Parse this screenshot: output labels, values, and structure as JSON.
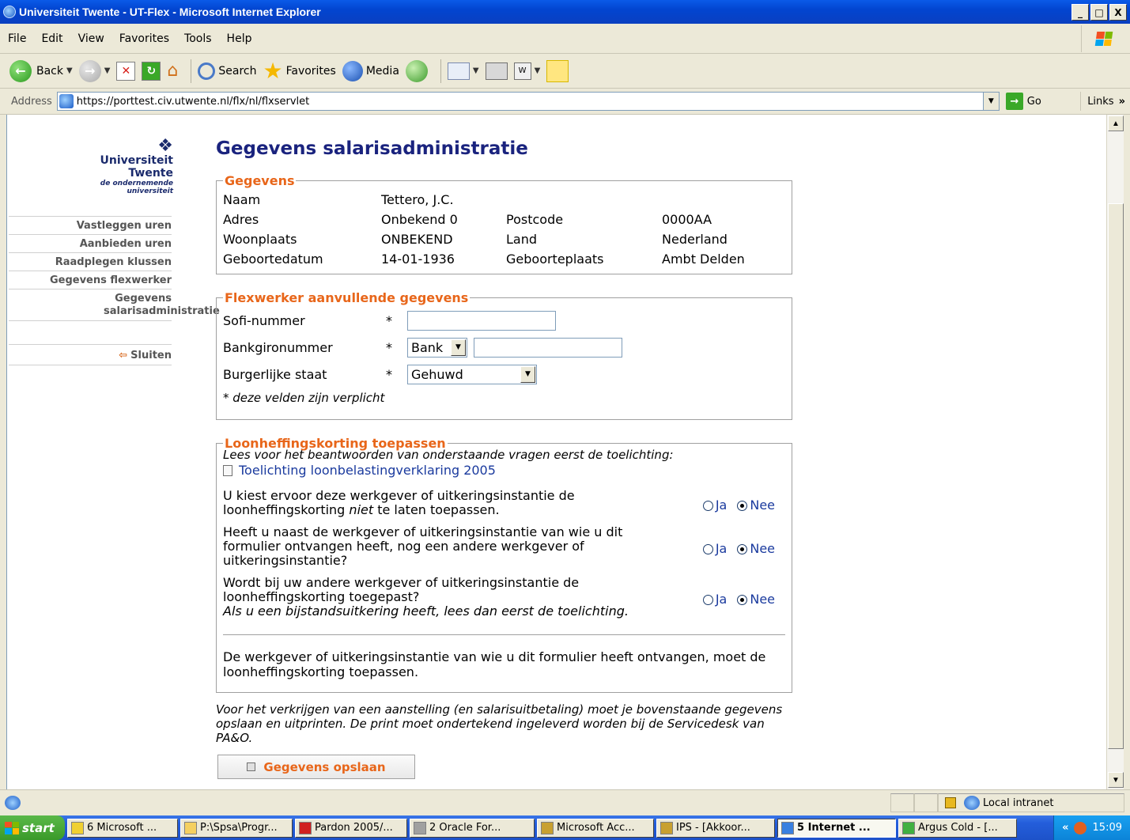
{
  "window": {
    "title": "Universiteit Twente - UT-Flex - Microsoft Internet Explorer",
    "minimize": "_",
    "maximize": "□",
    "close": "X"
  },
  "menu": [
    "File",
    "Edit",
    "View",
    "Favorites",
    "Tools",
    "Help"
  ],
  "toolbar": {
    "back": "Back",
    "search": "Search",
    "favorites": "Favorites",
    "media": "Media"
  },
  "address": {
    "label": "Address",
    "url": "https://porttest.civ.utwente.nl/flx/nl/flxservlet",
    "go": "Go",
    "links": "Links"
  },
  "logo": {
    "title": "Universiteit Twente",
    "subtitle": "de ondernemende universiteit"
  },
  "sidebar": {
    "items": [
      "Vastleggen uren",
      "Aanbieden uren",
      "Raadplegen klussen",
      "Gegevens flexwerker",
      "Gegevens salarisadministratie"
    ],
    "close": "Sluiten"
  },
  "page": {
    "title": "Gegevens salarisadministratie"
  },
  "gegevens": {
    "legend": "Gegevens",
    "naam_label": "Naam",
    "naam_value": "Tettero, J.C.",
    "adres_label": "Adres",
    "adres_value": "Onbekend 0",
    "postcode_label": "Postcode",
    "postcode_value": "0000AA",
    "woonplaats_label": "Woonplaats",
    "woonplaats_value": "ONBEKEND",
    "land_label": "Land",
    "land_value": "Nederland",
    "geboortedatum_label": "Geboortedatum",
    "geboortedatum_value": "14-01-1936",
    "geboorteplaats_label": "Geboorteplaats",
    "geboorteplaats_value": "Ambt Delden"
  },
  "aanvullend": {
    "legend": "Flexwerker aanvullende gegevens",
    "sofi_label": "Sofi-nummer",
    "sofi_value": "",
    "bank_label": "Bankgironummer",
    "bank_type": "Bank",
    "bank_value": "",
    "staat_label": "Burgerlijke staat",
    "staat_value": "Gehuwd",
    "required_mark": "*",
    "note": "* deze velden zijn verplicht"
  },
  "loonheffing": {
    "legend": "Loonheffingskorting toepassen",
    "intro": "Lees voor het beantwoorden van onderstaande vragen eerst de toelichting:",
    "link": "Toelichting loonbelastingverklaring 2005",
    "q1_a": "U kiest ervoor deze werkgever of uitkeringsinstantie de loonheffingskorting ",
    "q1_b": "niet",
    "q1_c": " te laten toepassen.",
    "q2": "Heeft u naast de werkgever of uitkeringsinstantie van wie u dit formulier ontvangen heeft, nog een andere werkgever of uitkeringsinstantie?",
    "q3": "Wordt bij uw andere werkgever of uitkeringsinstantie de loonheffingskorting toegepast?",
    "q3_note": "Als u een bijstandsuitkering heeft, lees dan eerst de toelichting.",
    "ja": "Ja",
    "nee": "Nee",
    "conclusion": "De werkgever of uitkeringsinstantie van wie u dit formulier heeft ontvangen, moet de loonheffingskorting toepassen."
  },
  "footnote": "Voor het verkrijgen van een aanstelling (en salarisuitbetaling) moet je bovenstaande gegevens opslaan en uitprinten. De print moet ondertekend ingeleverd worden bij de Servicedesk van PA&O.",
  "save_button": "Gegevens opslaan",
  "status": {
    "zone": "Local intranet"
  },
  "taskbar": {
    "start": "start",
    "tasks": [
      "6 Microsoft ...",
      "P:\\Spsa\\Progr...",
      "Pardon 2005/...",
      "2 Oracle For...",
      "Microsoft Acc...",
      "IPS - [Akkoor...",
      "5 Internet ...",
      "Argus Cold - [..."
    ],
    "clock": "15:09"
  },
  "colors": {
    "title_blue": "#1a237e",
    "legend_orange": "#e8661a",
    "link_blue": "#1a3a9e"
  }
}
